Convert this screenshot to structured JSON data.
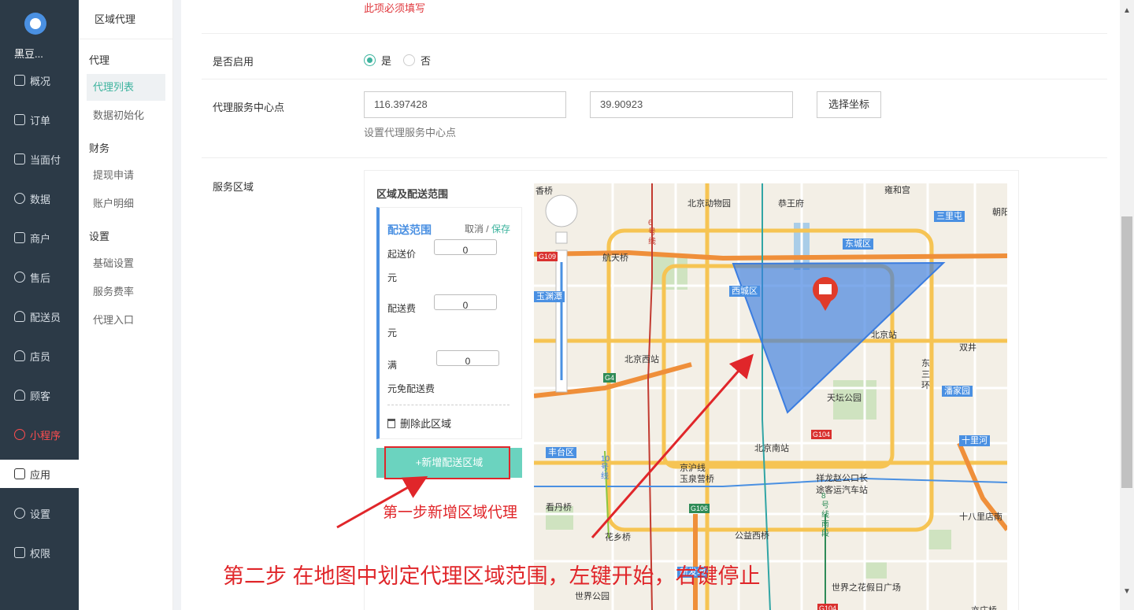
{
  "brand": "黑豆...",
  "nav": [
    {
      "label": "概况",
      "icon": "dashboard-icon"
    },
    {
      "label": "订单",
      "icon": "order-icon"
    },
    {
      "label": "当面付",
      "icon": "pay-icon"
    },
    {
      "label": "数据",
      "icon": "chart-icon"
    },
    {
      "label": "商户",
      "icon": "shop-icon"
    },
    {
      "label": "售后",
      "icon": "service-icon"
    },
    {
      "label": "配送员",
      "icon": "courier-icon"
    },
    {
      "label": "店员",
      "icon": "clerk-icon"
    },
    {
      "label": "顾客",
      "icon": "customer-icon"
    },
    {
      "label": "小程序",
      "icon": "miniapp-icon"
    },
    {
      "label": "应用",
      "icon": "apps-icon"
    },
    {
      "label": "设置",
      "icon": "gear-icon"
    },
    {
      "label": "权限",
      "icon": "lock-icon"
    }
  ],
  "subnav": {
    "title": "区域代理",
    "group_agent": "代理",
    "agent_list": "代理列表",
    "data_init": "数据初始化",
    "group_finance": "财务",
    "withdraw": "提现申请",
    "account_detail": "账户明细",
    "group_settings": "设置",
    "basic_settings": "基础设置",
    "service_rate": "服务费率",
    "agent_entry": "代理入口"
  },
  "form": {
    "required_msg": "此项必须填写",
    "enable_label": "是否启用",
    "enable_yes": "是",
    "enable_no": "否",
    "center_label": "代理服务中心点",
    "lng": "116.397428",
    "lat": "39.90923",
    "choose_coord": "选择坐标",
    "center_help": "设置代理服务中心点",
    "area_label": "服务区域"
  },
  "area_panel": {
    "title": "区域及配送范围",
    "range_title": "配送范围",
    "cancel": "取消",
    "sep": "/",
    "save": "保存",
    "min_price_label": "起送价",
    "min_price_value": "0",
    "yuan1": "元",
    "fee_label": "配送费",
    "fee_value": "0",
    "yuan2": "元",
    "full_label": "满",
    "full_value": "0",
    "free_label": "元免配送费",
    "delete": "删除此区域",
    "add_button": "+新增配送区域"
  },
  "map": {
    "labels": {
      "l1": "香桥",
      "l2": "北京动物园",
      "l3": "恭王府",
      "l4": "雍和宫",
      "l5": "航天桥",
      "l6": "东城区",
      "l7": "西城区",
      "l8": "北京西站",
      "l9": "北京站",
      "l10": "天坛公园",
      "l11": "丰台区",
      "l12": "北京南站",
      "l13": "京沪线",
      "l14": "玉泉营桥",
      "l15": "祥龙赵公口长",
      "l16": "途客运汽车站",
      "l17": "看丹桥",
      "l18": "花乡桥",
      "l19": "公益西桥",
      "l20": "世界公园",
      "l21": "世界之花假日广场",
      "l22": "十八里店南",
      "l23": "三里屯",
      "l24": "朝阳",
      "l25": "双井",
      "l26": "潘家园",
      "l27": "十里河",
      "l28": "东三环",
      "l29": "新发地",
      "l30": "6号线",
      "l31": "10号线",
      "l32": "8号线南段",
      "l33": "亦庄桥",
      "l34": "玉渊潭"
    },
    "roads": {
      "g109": "G109",
      "g4": "G4",
      "g104a": "G104",
      "g106": "G106",
      "g104b": "G104"
    }
  },
  "annotations": {
    "step1": "第一步新增区域代理",
    "step2": "第二步  在地图中划定代理区域范围，左键开始，右键停止"
  }
}
